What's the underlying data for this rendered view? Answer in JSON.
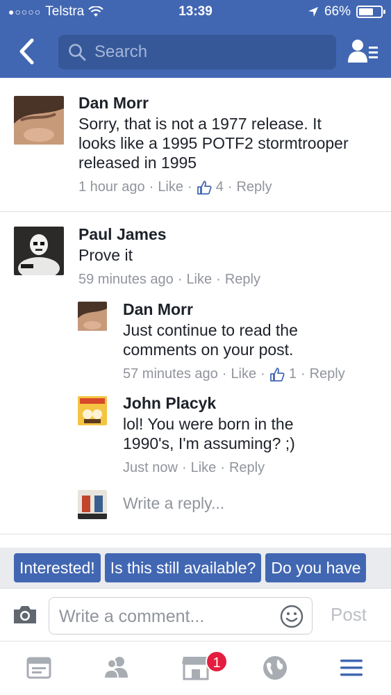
{
  "status_bar": {
    "carrier": "Telstra",
    "signal": "●○○○○",
    "time": "13:39",
    "battery": "66%",
    "battery_level": 0.66
  },
  "header": {
    "search_placeholder": "Search"
  },
  "comments": [
    {
      "author": "Dan Morr",
      "text_lines": [
        "Sorry, that is not a 1977 release.  It",
        "looks like a 1995 POTF2 stormtrooper",
        "released in 1995"
      ],
      "time": "1 hour ago",
      "like": "Like",
      "likes": "4",
      "reply": "Reply"
    },
    {
      "author": "Paul James",
      "text_lines": [
        "Prove it"
      ],
      "time": "59 minutes ago",
      "like": "Like",
      "reply": "Reply",
      "replies": [
        {
          "author": "Dan Morr",
          "text_lines": [
            "Just continue to read the",
            "comments on your post."
          ],
          "time": "57 minutes ago",
          "like": "Like",
          "likes": "1",
          "reply": "Reply"
        },
        {
          "author": "John Placyk",
          "text_lines": [
            "lol!  You were born in the",
            "1990's, I'm assuming?  ;)"
          ],
          "time": "Just now",
          "like": "Like",
          "reply": "Reply"
        }
      ]
    }
  ],
  "write_reply_placeholder": "Write a reply...",
  "quick_replies": [
    "Interested!",
    "Is this still available?",
    "Do you have"
  ],
  "composer": {
    "placeholder": "Write a comment...",
    "post_label": "Post"
  },
  "tabbar": {
    "marketplace_badge": "1"
  },
  "colors": {
    "brand": "#4267b2",
    "search_bg": "#365899",
    "meta_text": "#90949c",
    "badge": "#e41e3f"
  }
}
